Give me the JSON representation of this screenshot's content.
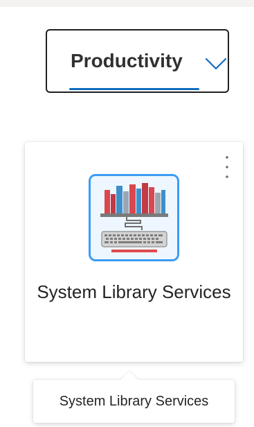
{
  "category_dropdown": {
    "selected": "Productivity",
    "chevron_icon": "chevron-down-icon",
    "accent_color": "#0f6cbd"
  },
  "app_tile": {
    "title": "System Library Services",
    "more_icon": "more-vertical-icon",
    "app_icon": "library-books-computer-icon",
    "icon_border_color": "#3b9cf5"
  },
  "tooltip": {
    "text": "System Library Services"
  }
}
